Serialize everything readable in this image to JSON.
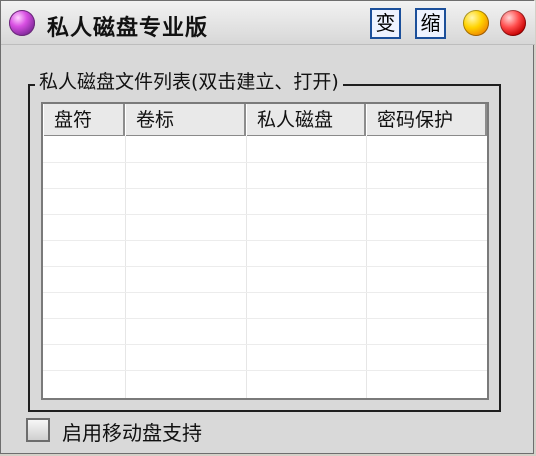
{
  "window": {
    "title": "私人磁盘专业版",
    "buttons": {
      "change_label": "变",
      "shrink_label": "缩"
    }
  },
  "group": {
    "title": "私人磁盘文件列表(双击建立、打开)"
  },
  "table": {
    "columns": [
      "盘符",
      "卷标",
      "私人磁盘",
      "密码保护"
    ],
    "rows": []
  },
  "options": {
    "removable_support_label": "启用移动盘支持",
    "removable_support_checked": false
  },
  "icons": [
    "app-icon",
    "minimize-icon",
    "close-icon",
    "checkbox-icon"
  ]
}
